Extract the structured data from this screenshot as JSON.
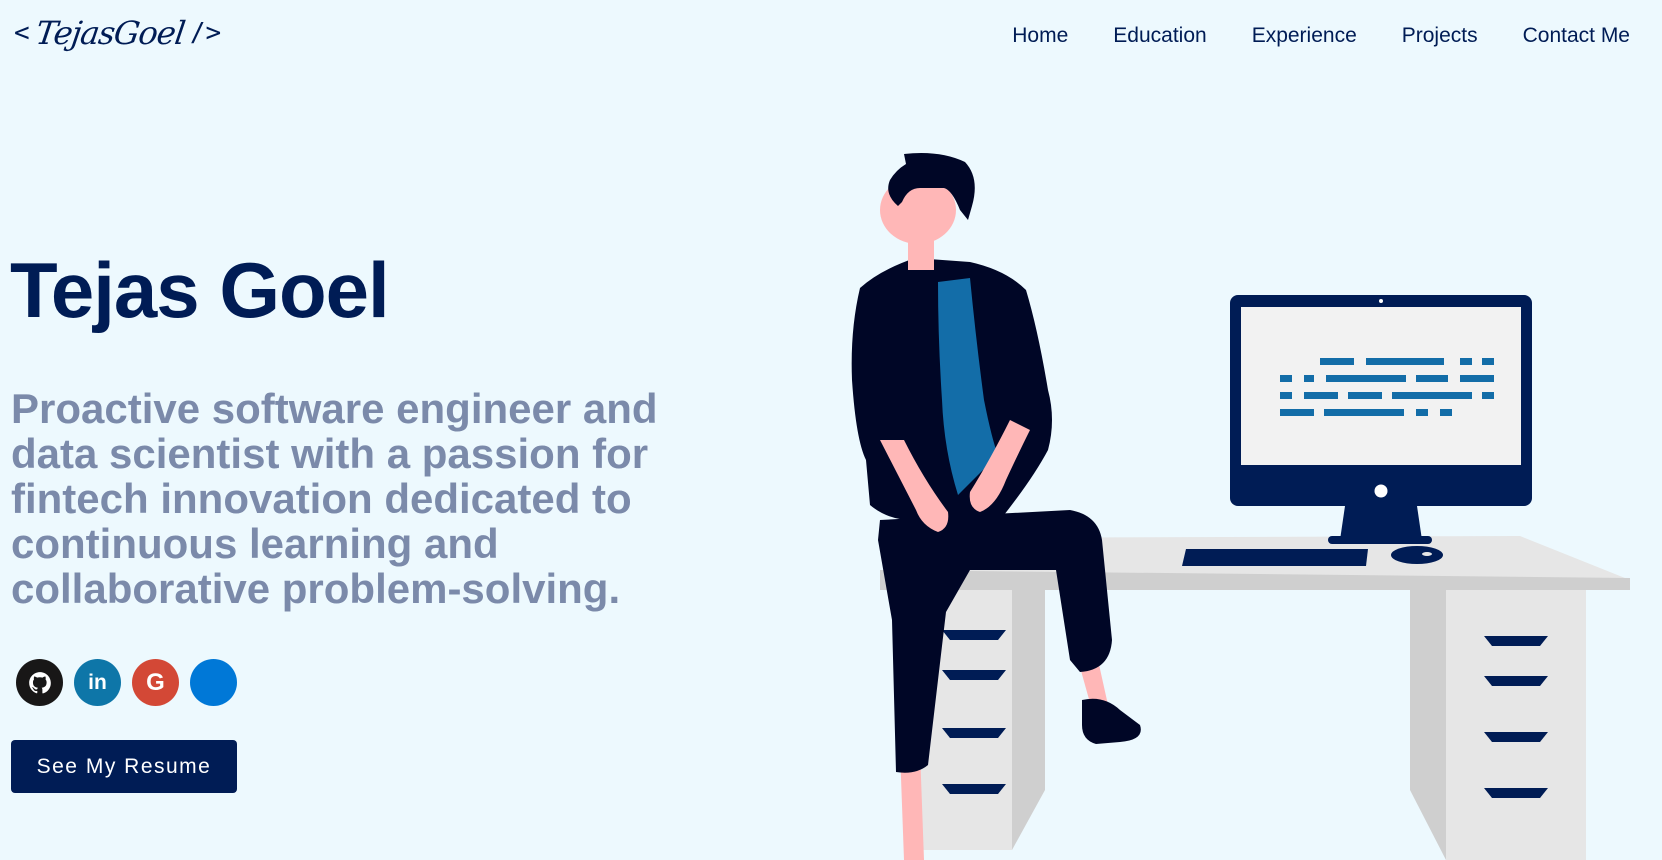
{
  "header": {
    "logo_open": "<",
    "logo_text": "TejasGoel",
    "logo_close": "/>",
    "nav": [
      "Home",
      "Education",
      "Experience",
      "Projects",
      "Contact Me"
    ]
  },
  "hero": {
    "name": "Tejas Goel",
    "subtitle": "Proactive software engineer and data scientist with a passion for fintech innovation dedicated to continuous learning and collaborative problem-solving.",
    "resume_button": "See My Resume"
  },
  "socials": [
    {
      "icon": "github-icon",
      "color": "#181717"
    },
    {
      "icon": "linkedin-icon",
      "label": "in",
      "color": "#0e76a8"
    },
    {
      "icon": "google-icon",
      "label": "G",
      "color": "#d34836"
    },
    {
      "icon": "blank-icon",
      "color": "#0078d7"
    }
  ],
  "colors": {
    "background": "#edf9fe",
    "primary": "#001c55",
    "subtitle": "#7b8aaa",
    "accent_blue": "#136da8"
  }
}
